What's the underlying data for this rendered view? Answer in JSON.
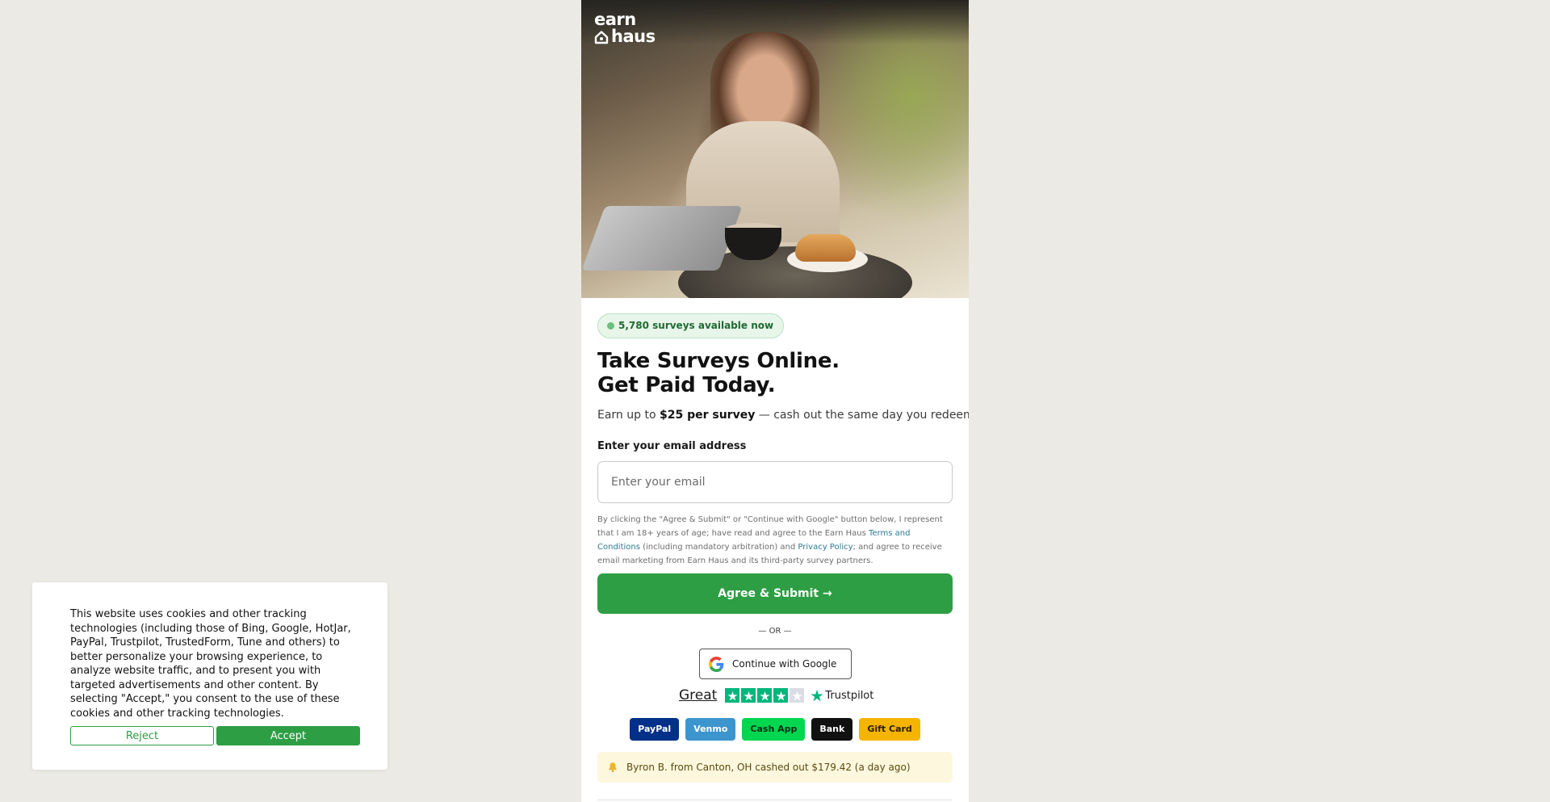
{
  "brand": {
    "logo_line1": "earn",
    "logo_line2": "haus"
  },
  "hero": {
    "alt": "Woman using phone at a sidewalk cafe"
  },
  "badge": {
    "text": "5,780 surveys available now"
  },
  "headline": {
    "line1": "Take Surveys Online.",
    "line2": "Get Paid Today."
  },
  "subtitle": {
    "prefix": "Earn up to ",
    "highlight": "$25 per survey",
    "suffix": " — cash out the same day you redeem."
  },
  "form": {
    "email_label": "Enter your email address",
    "email_placeholder": "Enter your email",
    "email_value": "",
    "legal_part1": "By clicking the \"Agree & Submit\" or \"Continue with Google\" button below, I represent that I am 18+ years of age; have read and agree to the Earn Haus ",
    "terms_link": "Terms and Conditions",
    "legal_part2": " (including mandatory arbitration) and ",
    "privacy_link": "Privacy Policy",
    "legal_part3": "; and agree to receive email marketing from Earn Haus and its third-party survey partners.",
    "submit_label": "Agree & Submit →",
    "or_label": "— OR —",
    "google_label": "Continue with Google"
  },
  "trustpilot": {
    "rating_text": "Great",
    "stars_filled": 4,
    "stars_total": 5,
    "brand": "Trustpilot",
    "star_color": "#00b67a"
  },
  "payouts": [
    {
      "label": "PayPal",
      "bg": "#003087",
      "fg": "#ffffff"
    },
    {
      "label": "Venmo",
      "bg": "#3d95ce",
      "fg": "#ffffff"
    },
    {
      "label": "Cash App",
      "bg": "#00d64f",
      "fg": "#0b2b14"
    },
    {
      "label": "Bank",
      "bg": "#111111",
      "fg": "#ffffff"
    },
    {
      "label": "Gift Card",
      "bg": "#f5b400",
      "fg": "#2a1d00"
    }
  ],
  "notice": {
    "icon": "bell-icon",
    "text": "Byron B. from Canton, OH cashed out $179.42 (a day ago)"
  },
  "cookie": {
    "text": "This website uses cookies and other tracking technologies (including those of Bing, Google, HotJar, PayPal, Trustpilot, TrustedForm, Tune and others) to better personalize your browsing experience, to analyze website traffic, and to present you with targeted advertisements and other content. By selecting \"Accept,\" you consent to the use of these cookies and other tracking technologies.",
    "reject_label": "Reject",
    "accept_label": "Accept"
  },
  "colors": {
    "primary_green": "#2e9e44",
    "page_bg": "#ebeae5",
    "link": "#2b7a95"
  }
}
